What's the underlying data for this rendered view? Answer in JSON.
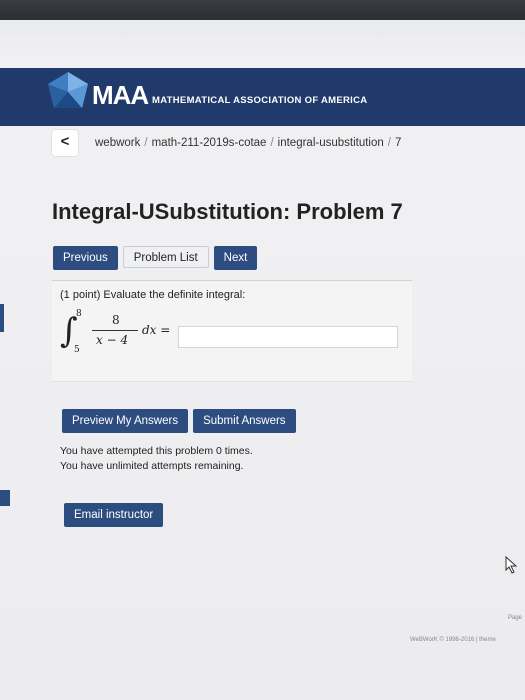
{
  "header": {
    "logo_text": "MAA",
    "logo_subtitle": "MATHEMATICAL ASSOCIATION OF AMERICA"
  },
  "breadcrumb": {
    "back_label": "<",
    "items": [
      "webwork",
      "math-211-2019s-cotae",
      "integral-usubstitution",
      "7"
    ],
    "separator": "/"
  },
  "page": {
    "title": "Integral-USubstitution: Problem 7"
  },
  "nav": {
    "previous": "Previous",
    "problem_list": "Problem List",
    "next": "Next"
  },
  "problem": {
    "prompt": "(1 point) Evaluate the definite integral:",
    "integral_upper": "8",
    "integral_lower": "5",
    "numerator": "8",
    "denominator": "x − 4",
    "differential": "dx =",
    "answer_value": ""
  },
  "actions": {
    "preview": "Preview My Answers",
    "submit": "Submit Answers"
  },
  "attempts": {
    "line1": "You have attempted this problem 0 times.",
    "line2": "You have unlimited attempts remaining."
  },
  "email_instructor": "Email instructor",
  "footer": {
    "page_label": "Page",
    "copyright": "WeBWorK © 1996-2016 | theme"
  },
  "colors": {
    "header_bg": "#1f3a6b",
    "button_blue": "#2d4d80"
  }
}
